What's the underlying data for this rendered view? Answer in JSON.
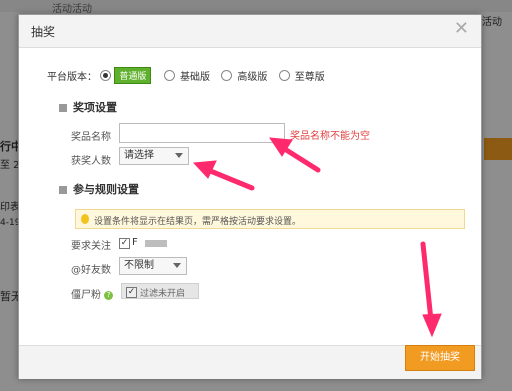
{
  "background": {
    "top_tab": "活动活动",
    "left_text_1": "行中",
    "left_text_2": "至 2",
    "left_text_3": "印表",
    "left_text_4": "4-19",
    "left_text_5": "暂无",
    "right_text": "活动"
  },
  "dialog": {
    "title": "抽奖",
    "close_symbol": "✕",
    "platform": {
      "label": "平台版本：",
      "options": [
        {
          "label": "普通版",
          "selected": true
        },
        {
          "label": "基础版",
          "selected": false
        },
        {
          "label": "高级版",
          "selected": false
        },
        {
          "label": "至尊版",
          "selected": false
        }
      ]
    },
    "prize_section": {
      "title": "奖项设置",
      "prize_name_label": "奖品名称",
      "prize_name_value": "",
      "prize_name_error": "奖品名称不能为空",
      "winners_label": "获奖人数",
      "winners_value": "请选择"
    },
    "rules_section": {
      "title": "参与规则设置",
      "notice": "设置条件将显示在结果页，需严格按活动要求设置。",
      "follow_label": "要求关注",
      "follow_value": "F",
      "friends_label": "@好友数",
      "friends_value": "不限制",
      "zombie_label": "僵尸粉",
      "zombie_help": "?",
      "zombie_filter_label": "过滤未开启"
    },
    "start_button": "开始抽奖"
  },
  "colors": {
    "accent_green": "#5fb02c",
    "error_red": "#e34141",
    "button_orange": "#f29b22",
    "arrow_pink": "#ff2a6d"
  }
}
